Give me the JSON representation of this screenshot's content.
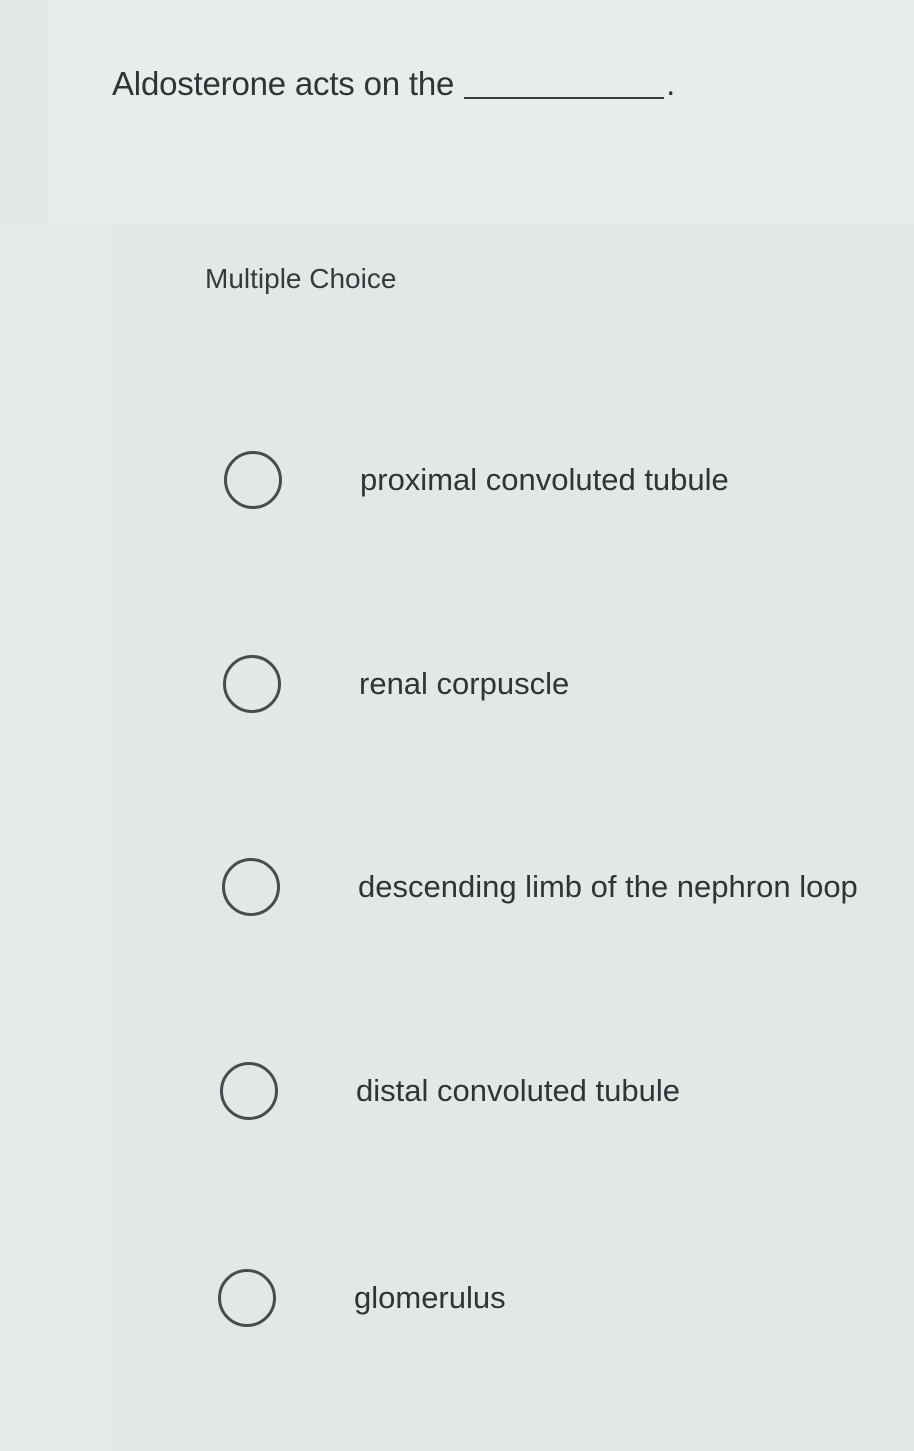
{
  "question": {
    "text": "Aldosterone acts on the",
    "end_punctuation": "."
  },
  "section": {
    "label": "Multiple Choice"
  },
  "choices": [
    {
      "label": "proximal convoluted tubule",
      "selected": false
    },
    {
      "label": "renal corpuscle",
      "selected": false
    },
    {
      "label": "descending limb of the nephron loop",
      "selected": false
    },
    {
      "label": "distal convoluted tubule",
      "selected": false
    },
    {
      "label": "glomerulus",
      "selected": false
    }
  ],
  "colors": {
    "background": "#e4e9e9",
    "text": "#2f3437",
    "radio_border": "#474c4f"
  }
}
